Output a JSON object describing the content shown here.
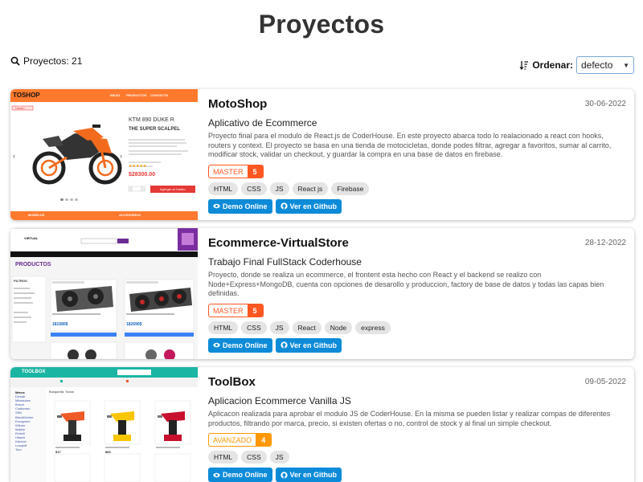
{
  "page": {
    "title": "Proyectos"
  },
  "toolbar": {
    "count_label": "Proyectos: 21",
    "sort_label": "Ordenar:",
    "sort_value": "defecto"
  },
  "projects": [
    {
      "title": "MotoShop",
      "date": "30-06-2022",
      "subtitle": "Aplicativo de Ecommerce",
      "description": "Proyecto final para el modulo de React.js de CoderHouse. En este proyecto abarca todo lo realacionado a react con hooks, routers y context. El proyecto se basa en una tienda de motocicletas, donde podes filtrar, agregar a favoritos, sumar al carrito, modificar stock, validar un checkout, y guardar la compra en una base de datos en firebase.",
      "level_label": "MASTER",
      "level_value": "5",
      "level_color": "#ff5722",
      "tags": [
        "HTML",
        "CSS",
        "JS",
        "React js",
        "Firebase"
      ],
      "demo_label": "Demo Online",
      "github_label": "Ver en Github",
      "thumb": {
        "logo": "TOSHOP",
        "nav": [
          "INICIO",
          "PRODUCTOS",
          "CONTACTO"
        ],
        "badge": "Usado",
        "product": "KTM 890 DUKE R",
        "tagline": "THE SUPER SCALPEL",
        "price": "$28300.00",
        "cart_button": "Agregar al Carrito",
        "footer": [
          "MODELOS",
          "ACCESORIOS"
        ]
      }
    },
    {
      "title": "Ecommerce-VirtualStore",
      "date": "28-12-2022",
      "subtitle": "Trabajo Final FullStack Coderhouse",
      "description": "Proyecto, donde se realiza un ecommerce, el frontent esta hecho con React y el backend se realizo con Node+Express+MongoDB, cuenta con opciones de desarollo y produccion, factory de base de datos y todas las capas bien definidas.",
      "level_label": "MASTER",
      "level_value": "5",
      "level_color": "#ff5722",
      "tags": [
        "HTML",
        "CSS",
        "JS",
        "React",
        "Node",
        "express"
      ],
      "demo_label": "Demo Online",
      "github_label": "Ver en Github",
      "thumb": {
        "logo": "VIRTUAL",
        "heading": "PRODUCTOS",
        "filter": "FILTROS",
        "price_1": "181580$",
        "price_2": "182690$"
      }
    },
    {
      "title": "ToolBox",
      "date": "09-05-2022",
      "subtitle": "Aplicacion Ecommerce Vanilla JS",
      "description": "Aplicacon realizada para aprobar el modulo JS de CoderHouse. En la misma se pueden listar y realizar compas de diferentes productos, filtrando por marca, precio, si existen ofertas o no, control de stock y al final un simple checkout.",
      "level_label": "AVANZADO",
      "level_value": "4",
      "level_color": "#ff9800",
      "tags": [
        "HTML",
        "CSS",
        "JS"
      ],
      "demo_label": "Demo Online",
      "github_label": "Ver en Github",
      "thumb": {
        "logo": "TOOLBOX",
        "heading": "Busqueda: Todos",
        "brands": [
          "Marca",
          "Dewalt",
          "Milwaukee",
          "Bosch",
          "Craftsman",
          "Stihl",
          "BlackDecker",
          "Evergreen",
          "Wilmer",
          "Makita",
          "Einhell",
          "Hitachi",
          "Kärcher",
          "Lusqtoff",
          "Toro"
        ],
        "price_1": "517",
        "price_2": "883"
      }
    }
  ],
  "colors": {
    "primary": "#0d8bd8",
    "master": "#ff5722",
    "advanced": "#ff9800",
    "tag_bg": "#e4e4e4"
  }
}
